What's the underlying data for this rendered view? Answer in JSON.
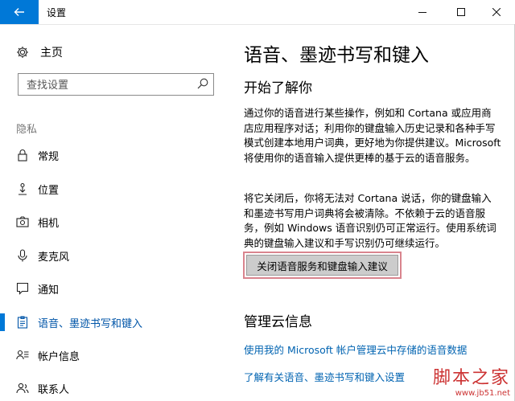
{
  "window": {
    "title": "设置"
  },
  "sidebar": {
    "home_label": "主页",
    "search_placeholder": "查找设置",
    "section_label": "隐私",
    "items": [
      {
        "label": "常规",
        "icon": "lock-icon"
      },
      {
        "label": "位置",
        "icon": "location-person-icon"
      },
      {
        "label": "相机",
        "icon": "camera-icon"
      },
      {
        "label": "麦克风",
        "icon": "microphone-icon"
      },
      {
        "label": "通知",
        "icon": "notification-icon"
      },
      {
        "label": "语音、墨迹书写和键入",
        "icon": "clipboard-icon",
        "active": true
      },
      {
        "label": "帐户信息",
        "icon": "account-info-icon"
      },
      {
        "label": "联系人",
        "icon": "contacts-icon"
      }
    ]
  },
  "main": {
    "title": "语音、墨迹书写和键入",
    "section1_heading": "开始了解你",
    "para1": "通过你的语音进行某些操作，例如和 Cortana 或应用商店应用程序对话；利用你的键盘输入历史记录和各种手写模式创建本地用户词典，更好地为你提供建议。Microsoft 将使用你的语音输入提供更棒的基于云的语音服务。",
    "para2": "将它关闭后，你将无法对 Cortana 说话，你的键盘输入和墨迹书写用户词典将会被清除。不依赖于云的语音服务，例如 Windows 语音识别仍可正常运行。使用系统词典的键盘输入建议和手写识别仍可继续运行。",
    "button_label": "关闭语音服务和键盘输入建议",
    "section2_heading": "管理云信息",
    "link1": "使用我的 Microsoft 帐户管理云中存储的语音数据",
    "link2": "了解有关语音、墨迹书写和键入设置"
  },
  "watermark": {
    "main": "脚本之家",
    "url": "www.jb51.net"
  },
  "colors": {
    "accent": "#0078d7",
    "link": "#0063b1",
    "highlight_border": "#d9848e"
  }
}
